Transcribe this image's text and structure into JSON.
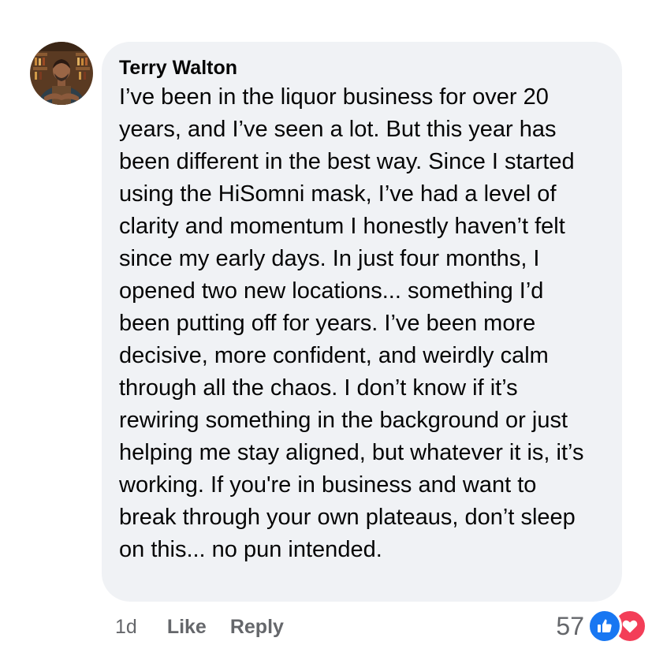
{
  "comment": {
    "author": "Terry Walton",
    "text": "I’ve been in the liquor business for over 20 years, and I’ve seen a lot. But this year has been different in the best way. Since I started using the HiSomni mask, I’ve had a level of clarity and momentum I honestly haven’t felt since my early days. In just four months, I opened two new locations... something I’d been putting off for years. I’ve been more decisive, more confident, and weirdly calm through all the chaos. I don’t know if it’s rewiring something in the background or just helping me stay aligned, but whatever it is, it’s working. If you're in business and want to break through your own plateaus, don’t sleep on this... no pun intended.",
    "timestamp": "1d",
    "like_label": "Like",
    "reply_label": "Reply",
    "reaction_count": "57",
    "reactions": [
      "like-icon",
      "love-icon"
    ]
  },
  "colors": {
    "bubble": "#f0f2f5",
    "secondary_text": "#65676b",
    "like_blue": "#1877f2",
    "love_red": "#f33e58"
  }
}
